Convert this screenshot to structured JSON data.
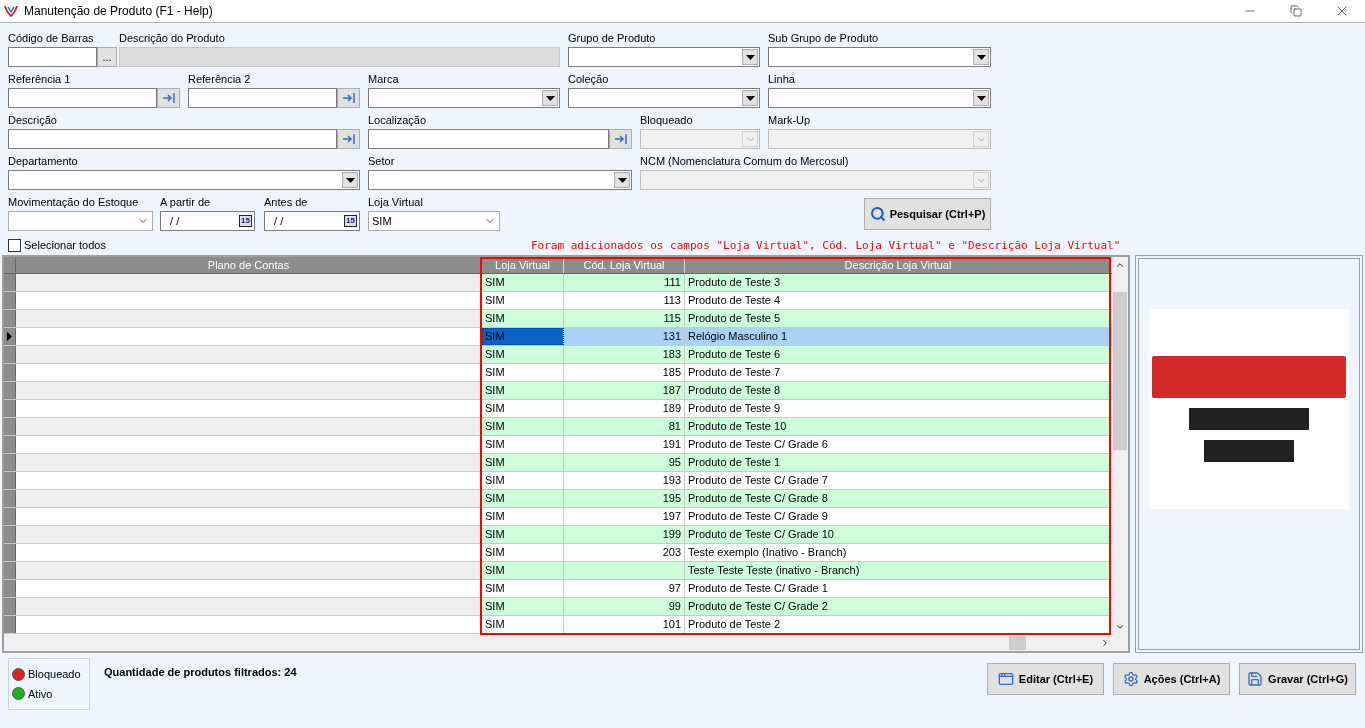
{
  "window": {
    "title": "Manutenção de Produto (F1 - Help)"
  },
  "filter_rows": [
    {
      "fields": [
        {
          "label": "Código de Barras",
          "kind": "browse",
          "button": "..."
        },
        {
          "label": "Descrição do Produto",
          "kind": "readonly"
        },
        {
          "label": "Grupo de Produto",
          "kind": "dropdown"
        },
        {
          "label": "Sub Grupo de Produto",
          "kind": "dropdown"
        }
      ]
    },
    {
      "fields": [
        {
          "label": "Referência 1",
          "kind": "lookup"
        },
        {
          "label": "Referência 2",
          "kind": "lookup"
        },
        {
          "label": "Marca",
          "kind": "dropdown"
        },
        {
          "label": "Coleção",
          "kind": "dropdown"
        },
        {
          "label": "Linha",
          "kind": "dropdown"
        }
      ]
    },
    {
      "fields": [
        {
          "label": "Descrição",
          "kind": "lookup"
        },
        {
          "label": "Localização",
          "kind": "lookup"
        },
        {
          "label": "Bloqueado",
          "kind": "dropdown-disabled"
        },
        {
          "label": "Mark-Up",
          "kind": "dropdown-disabled"
        }
      ]
    },
    {
      "fields": [
        {
          "label": "Departamento",
          "kind": "dropdown"
        },
        {
          "label": "Setor",
          "kind": "dropdown"
        },
        {
          "label": "NCM (Nomenclatura Comum do Mercosul)",
          "kind": "dropdown-disabled"
        }
      ]
    },
    {
      "fields": [
        {
          "label": "Movimentação do Estoque",
          "kind": "dropdown-flat"
        },
        {
          "label": "A partir de",
          "kind": "date",
          "value": " / /",
          "button": "15"
        },
        {
          "label": "Antes de",
          "kind": "date",
          "value": " / /",
          "button": "15"
        },
        {
          "label": "Loja Virtual",
          "kind": "dropdown-flat",
          "value": "SIM"
        }
      ]
    }
  ],
  "search_button": "Pesquisar (Ctrl+P)",
  "select_all": {
    "label": "Selecionar todos",
    "checked": false
  },
  "annotation": "Foram adicionados os campos \"Loja Virtual\", Cód. Loja Virtual\" e \"Descrição Loja Virtual\"",
  "table": {
    "columns": [
      "Plano de Contas",
      "Loja Virtual",
      "Cód. Loja Virtual",
      "Descrição Loja Virtual"
    ],
    "rows": [
      {
        "loja": "SIM",
        "codigo": "111",
        "descricao": "Produto de Teste 3",
        "selected": false
      },
      {
        "loja": "SIM",
        "codigo": "113",
        "descricao": "Produto de Teste 4",
        "selected": false
      },
      {
        "loja": "SIM",
        "codigo": "115",
        "descricao": "Produto de Teste 5",
        "selected": false
      },
      {
        "loja": "SIM",
        "codigo": "131",
        "descricao": "Relógio Masculino 1",
        "selected": true
      },
      {
        "loja": "SIM",
        "codigo": "183",
        "descricao": "Produto de Teste 6",
        "selected": false
      },
      {
        "loja": "SIM",
        "codigo": "185",
        "descricao": "Produto de Teste 7",
        "selected": false
      },
      {
        "loja": "SIM",
        "codigo": "187",
        "descricao": "Produto de Teste 8",
        "selected": false
      },
      {
        "loja": "SIM",
        "codigo": "189",
        "descricao": "Produto de Teste 9",
        "selected": false
      },
      {
        "loja": "SIM",
        "codigo": "81",
        "descricao": "Produto de Teste 10",
        "selected": false
      },
      {
        "loja": "SIM",
        "codigo": "191",
        "descricao": "Produto de Teste C/ Grade 6",
        "selected": false
      },
      {
        "loja": "SIM",
        "codigo": "95",
        "descricao": "Produto de Teste 1",
        "selected": false
      },
      {
        "loja": "SIM",
        "codigo": "193",
        "descricao": "Produto de Teste C/ Grade 7",
        "selected": false
      },
      {
        "loja": "SIM",
        "codigo": "195",
        "descricao": "Produto de Teste C/ Grade 8",
        "selected": false
      },
      {
        "loja": "SIM",
        "codigo": "197",
        "descricao": "Produto de Teste C/ Grade 9",
        "selected": false
      },
      {
        "loja": "SIM",
        "codigo": "199",
        "descricao": "Produto de Teste C/ Grade 10",
        "selected": false
      },
      {
        "loja": "SIM",
        "codigo": "203",
        "descricao": "Teste exemplo (Inativo - Branch)",
        "selected": false
      },
      {
        "loja": "SIM",
        "descricao": "Teste Teste Teste (inativo - Branch)",
        "selected": false
      },
      {
        "loja": "SIM",
        "codigo": "97",
        "descricao": "Produto de Teste C/ Grade 1",
        "selected": false
      },
      {
        "loja": "SIM",
        "codigo": "99",
        "descricao": "Produto de Teste C/ Grade 2",
        "selected": false
      },
      {
        "loja": "SIM",
        "codigo": "101",
        "descricao": "Produto de Teste 2",
        "selected": false
      }
    ]
  },
  "legend": [
    {
      "label": "Bloqueado",
      "color": "#e02020"
    },
    {
      "label": "Ativo",
      "color": "#20b020"
    }
  ],
  "count_text": "Quantidade de produtos filtrados: 24",
  "actions": [
    {
      "label": "Editar (Ctrl+E)",
      "kind": "edit"
    },
    {
      "label": "Ações (Ctrl+A)",
      "kind": "actions"
    },
    {
      "label": "Gravar (Ctrl+G)",
      "kind": "save"
    }
  ]
}
